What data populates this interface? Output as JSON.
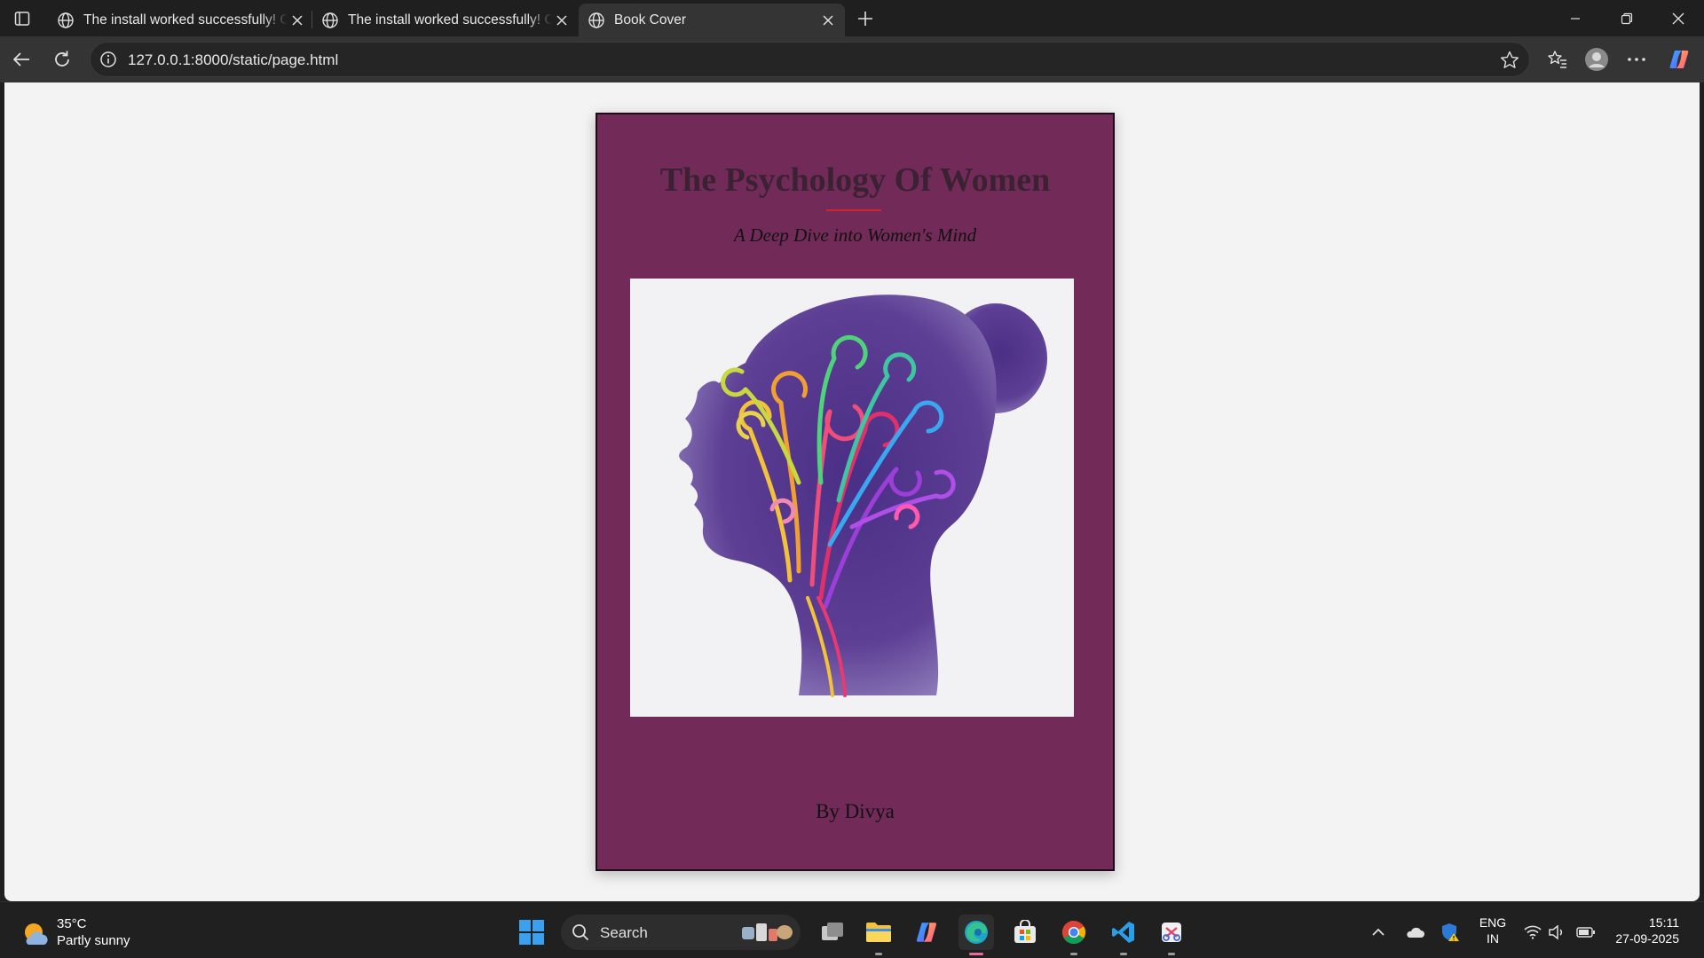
{
  "browser": {
    "tabs": [
      {
        "title": "The install worked successfully! Congratulations!",
        "active": false
      },
      {
        "title": "The install worked successfully! Congratulations!",
        "active": false
      },
      {
        "title": "Book Cover",
        "active": true
      }
    ],
    "url": "127.0.0.1:8000/static/page.html"
  },
  "cover": {
    "title": "The Psychology Of Women",
    "subtitle": "A Deep Dive into Women's Mind",
    "author": "By Divya",
    "background_color": "#722b58",
    "accent_rule_color": "#d0242a",
    "art_icon": "woman-head-silhouette-with-colorful-swirls"
  },
  "taskbar": {
    "weather": {
      "temp": "35°C",
      "condition": "Partly sunny"
    },
    "search_label": "Search",
    "apps": [
      "task-view",
      "file-explorer",
      "copilot",
      "edge",
      "microsoft-store",
      "chrome",
      "vscode",
      "snipping-tool"
    ],
    "language": {
      "line1": "ENG",
      "line2": "IN"
    },
    "clock": {
      "time": "15:11",
      "date": "27-09-2025"
    }
  }
}
